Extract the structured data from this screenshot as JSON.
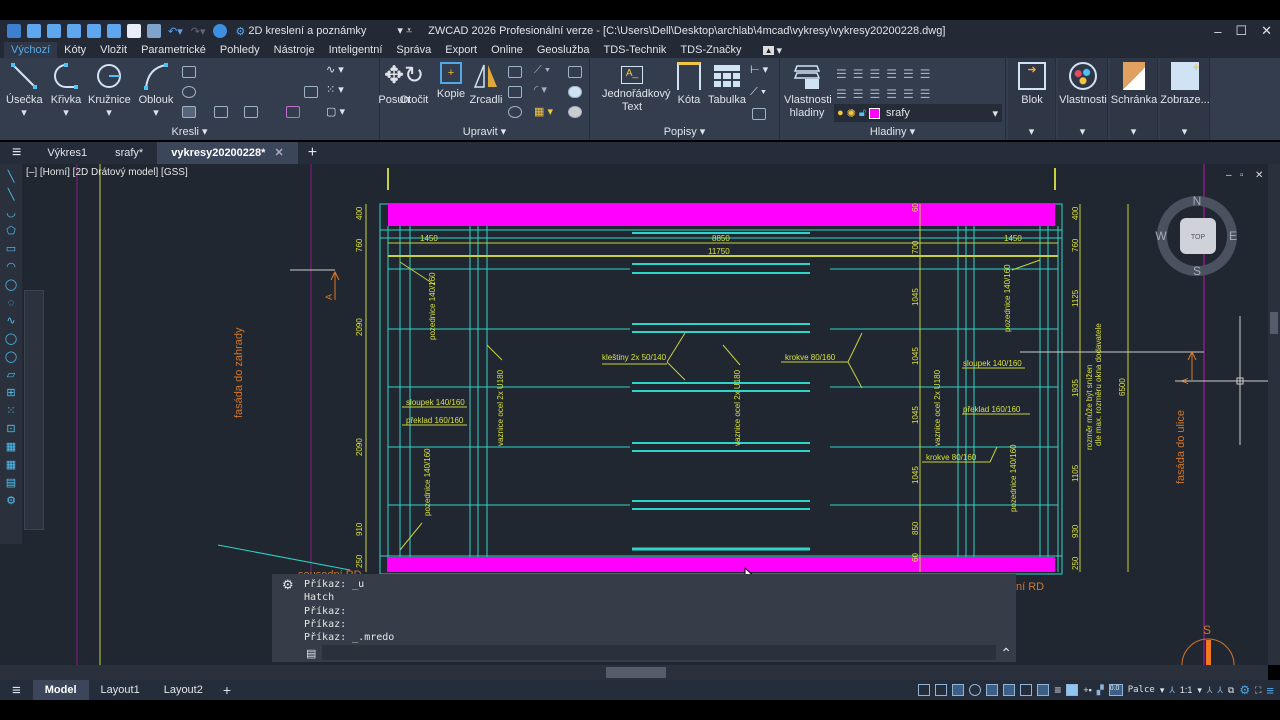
{
  "app": {
    "title": "ZWCAD 2026 Profesionální verze - [C:\\Users\\Dell\\Desktop\\archlab\\4mcad\\vykresy\\vykresy20200228.dwg]",
    "workspace": "2D kreslení a poznámky"
  },
  "menu_tabs": [
    "Výchozí",
    "Kóty",
    "Vložit",
    "Parametrické",
    "Pohledy",
    "Nástroje",
    "Inteligentní",
    "Správa",
    "Export",
    "Online",
    "Geoslužba",
    "TDS-Technik",
    "TDS-Značky"
  ],
  "ribbon": {
    "kresli": {
      "label": "Kresli",
      "buttons": [
        "Úsečka",
        "Křivka",
        "Kružnice",
        "Oblouk"
      ]
    },
    "upravit": {
      "label": "Upravit",
      "buttons": [
        "Posun",
        "Otočit",
        "Kopie",
        "Zrcadli"
      ]
    },
    "popisy": {
      "label": "Popisy",
      "buttons": [
        "Jednořádkový Text",
        "Kóta",
        "Tabulka"
      ]
    },
    "hladiny": {
      "label": "Hladiny",
      "button": "Vlastnosti hladiny",
      "current_layer": "srafy",
      "layer_color": "#ff00ff"
    },
    "blok": "Blok",
    "vlastnosti": "Vlastnosti",
    "schranka": "Schránka",
    "zobrazeni": "Zobraze..."
  },
  "doc_tabs": [
    "Výkres1",
    "srafy*",
    "vykresy20200228*"
  ],
  "viewport_label": "[–] [Horní] [2D Drátový model] [GSS]",
  "viewcube": {
    "n": "N",
    "s": "S",
    "e": "E",
    "w": "W",
    "top": "TOP"
  },
  "drawing": {
    "dims_top": [
      "1450",
      "8850",
      "11750",
      "1450"
    ],
    "dims_left": [
      "400",
      "760",
      "2090",
      "2090",
      "910",
      "250"
    ],
    "dims_mid": [
      "60",
      "700",
      "1045",
      "1045",
      "1045",
      "1045",
      "850",
      "60"
    ],
    "dims_right": [
      "400",
      "760",
      "1125",
      "1935",
      "1105",
      "930",
      "250"
    ],
    "dim_total": "6500",
    "note_lines": [
      "rozměr může být snížen",
      "dle max. rozměru okna dodavatele"
    ],
    "labels": {
      "pozednice": "pozednice 140/160",
      "vaznice": "vaznice ocel 2x U180",
      "klestiny": "kleštiny 2x 50/140",
      "krokve": "krokve 80/160",
      "sloupek": "sloupek 140/160",
      "preklad": "překlad 160/160"
    },
    "fasada_zahrada": "fasáda do zahrady",
    "fasada_ulice": "fasáda do ulice",
    "soused_left": "sousední RD",
    "soused_right": "ní RD",
    "section": "A",
    "south": "S"
  },
  "command_history": [
    "Příkaz: _u",
    "Hatch",
    "Příkaz:",
    "Příkaz:",
    "Příkaz: _.mredo"
  ],
  "layout_tabs": [
    "Model",
    "Layout1",
    "Layout2"
  ],
  "status": {
    "units": "Palce",
    "scale": "1:1"
  }
}
